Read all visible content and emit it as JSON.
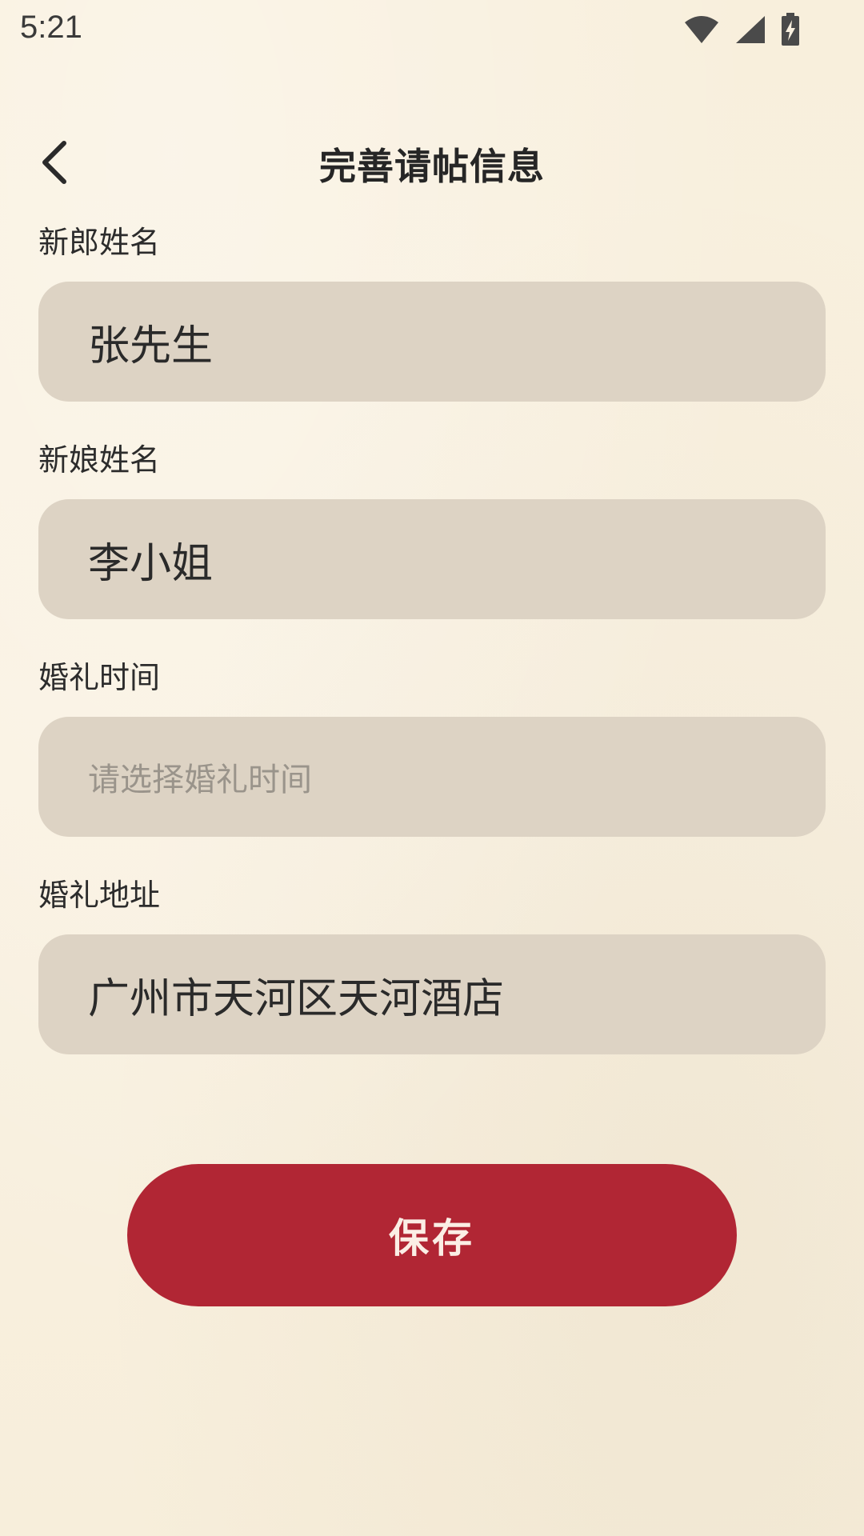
{
  "status_bar": {
    "time": "5:21",
    "icons": [
      "wifi-icon",
      "signal-icon",
      "battery-charging-icon"
    ]
  },
  "app_bar": {
    "back_icon": "chevron-left-icon",
    "title": "完善请帖信息"
  },
  "form": {
    "groom_name": {
      "label": "新郎姓名",
      "value": "张先生",
      "placeholder": ""
    },
    "bride_name": {
      "label": "新娘姓名",
      "value": "李小姐",
      "placeholder": ""
    },
    "wedding_time": {
      "label": "婚礼时间",
      "value": "",
      "placeholder": "请选择婚礼时间"
    },
    "wedding_address": {
      "label": "婚礼地址",
      "value": "广州市天河区天河酒店",
      "placeholder": ""
    }
  },
  "actions": {
    "save_label": "保存"
  },
  "colors": {
    "background": "#f9f0df",
    "input_background": "#ddd3c4",
    "primary": "#b12634",
    "primary_text": "#fbeee5",
    "placeholder_text": "#9a948b"
  }
}
